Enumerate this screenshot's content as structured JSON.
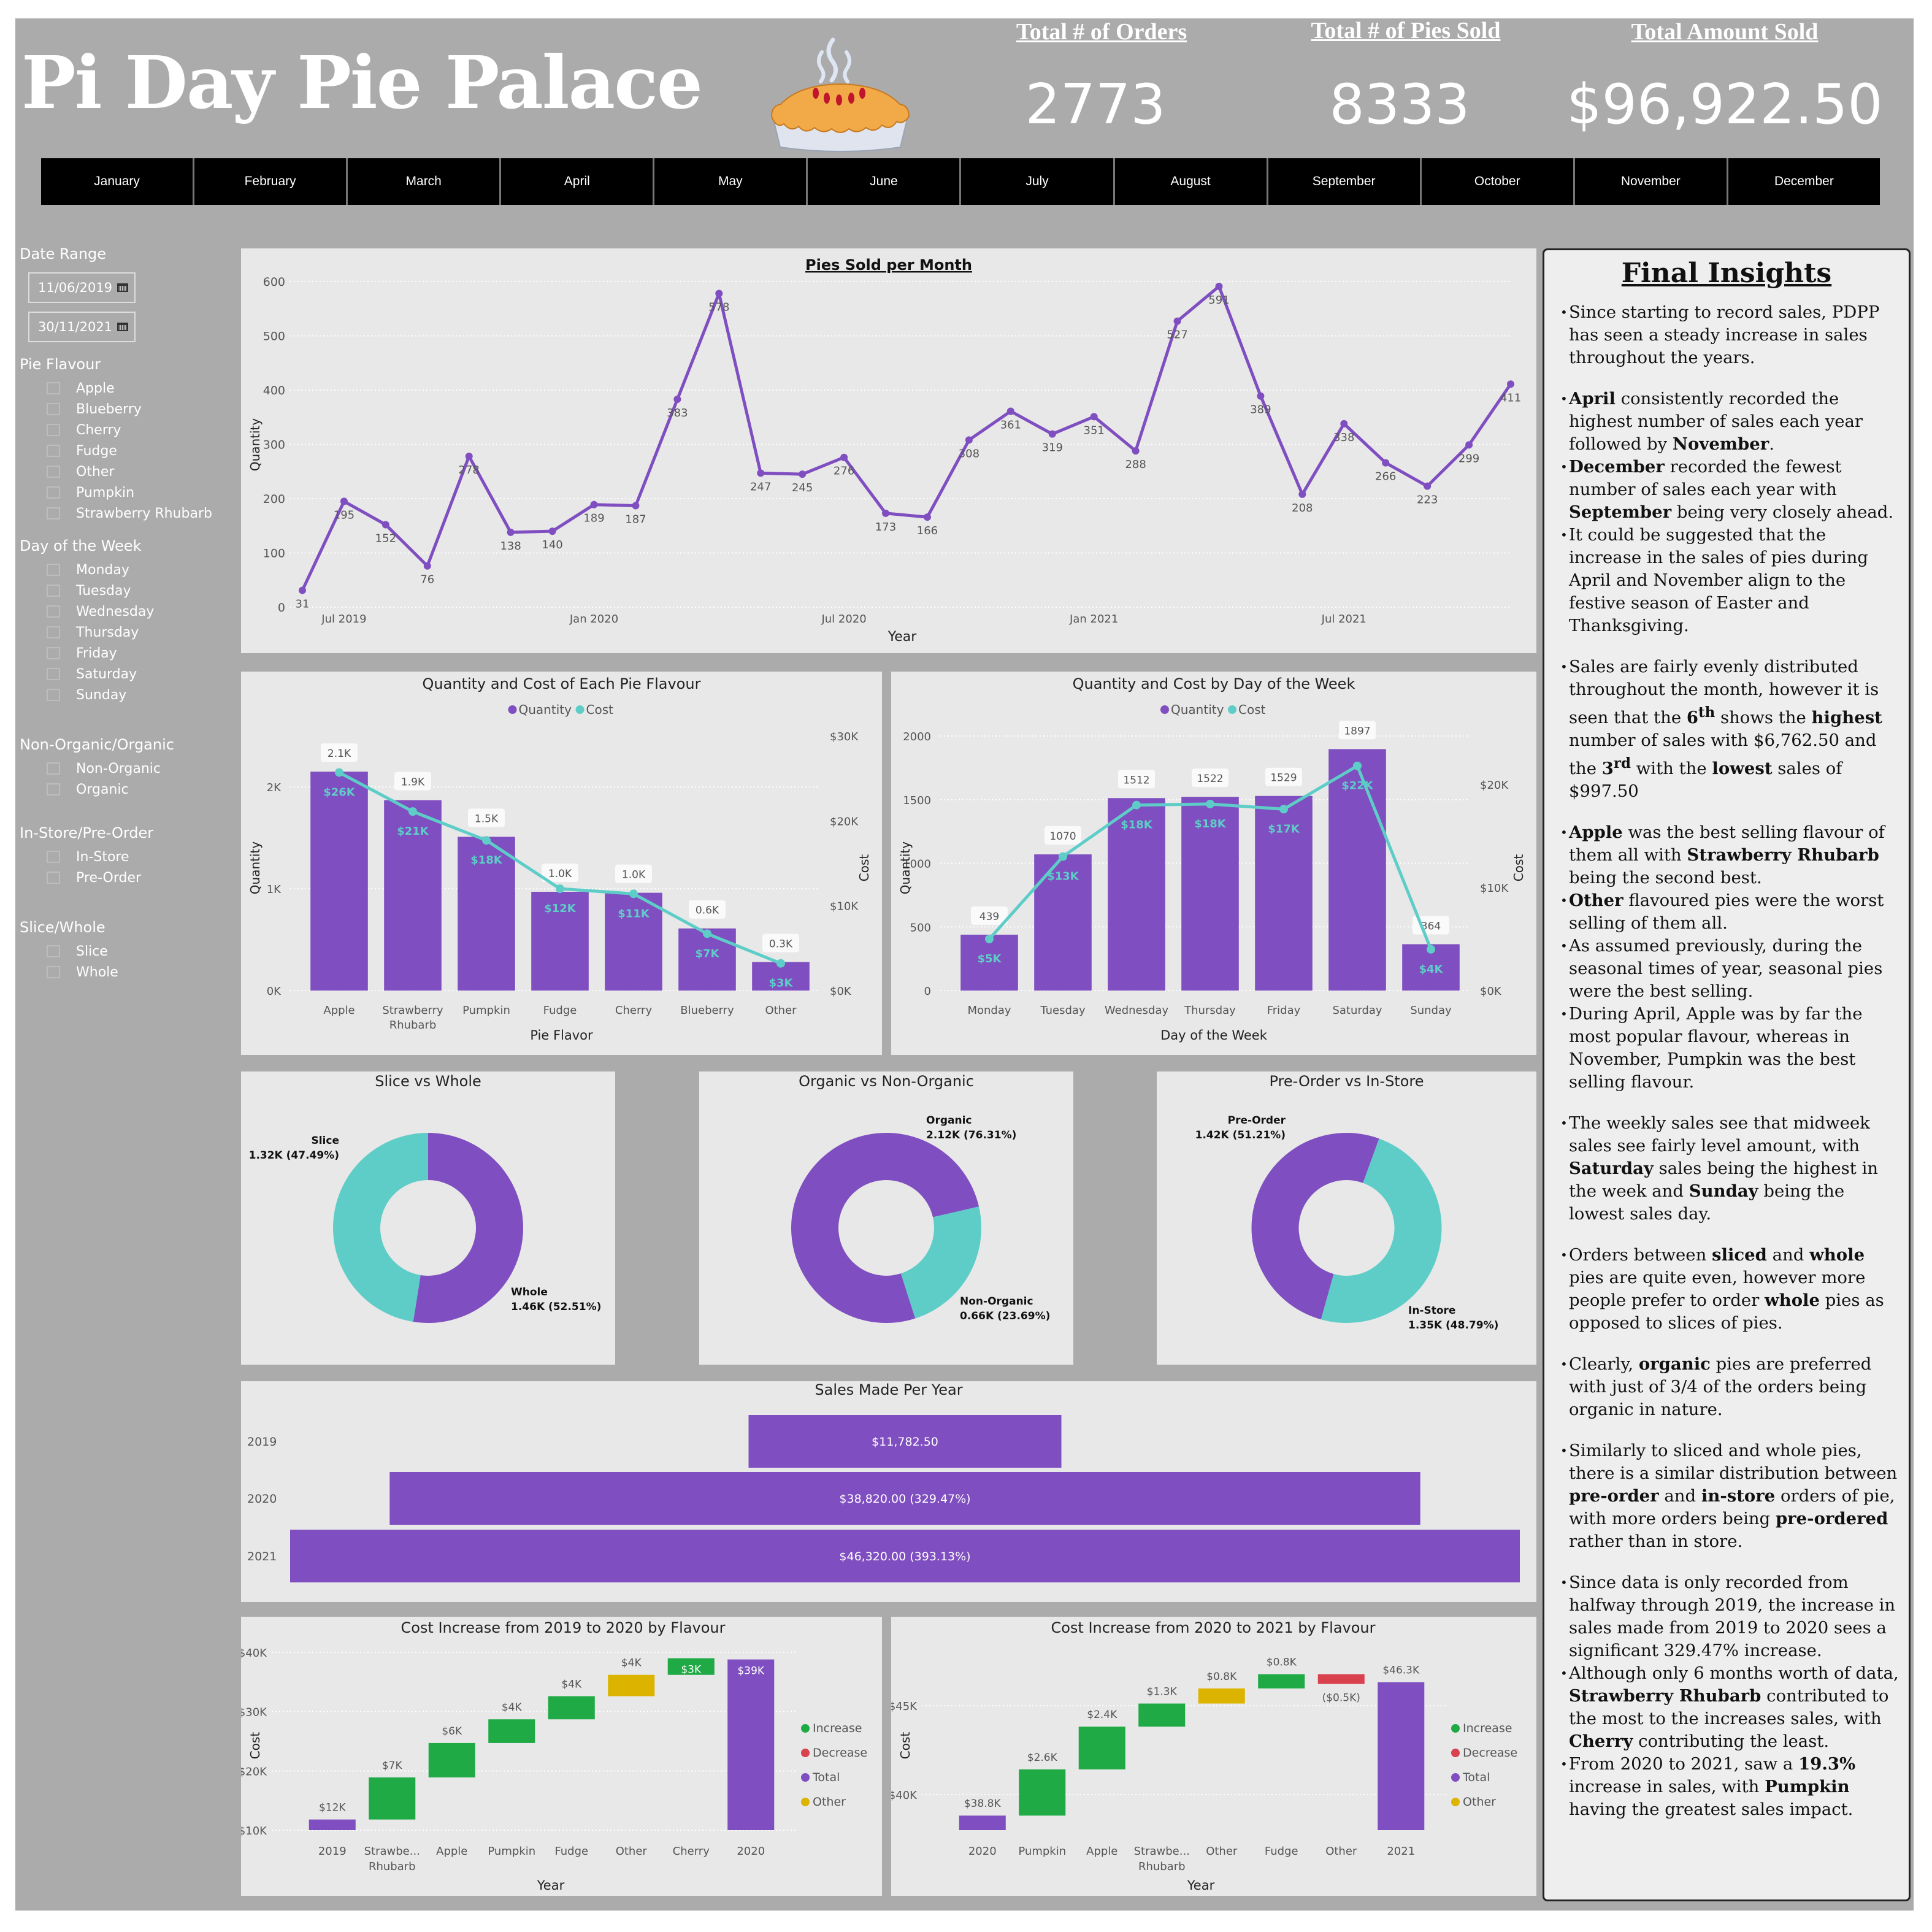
{
  "header": {
    "title": "Pi Day Pie Palace",
    "logo_icon": "pie-icon",
    "kpis": [
      {
        "label": "Total # of Orders",
        "value": "2773"
      },
      {
        "label": "Total # of Pies Sold",
        "value": "8333"
      },
      {
        "label": "Total Amount Sold",
        "value": "$96,922.50"
      }
    ],
    "months": [
      "January",
      "February",
      "March",
      "April",
      "May",
      "June",
      "July",
      "August",
      "September",
      "October",
      "November",
      "December"
    ]
  },
  "filters": {
    "date_range": {
      "label": "Date Range",
      "start": "11/06/2019",
      "end": "30/11/2021",
      "icon": "calendar-icon"
    },
    "groups": [
      {
        "label": "Pie Flavour",
        "options": [
          "Apple",
          "Blueberry",
          "Cherry",
          "Fudge",
          "Other",
          "Pumpkin",
          "Strawberry Rhubarb"
        ]
      },
      {
        "label": "Day of the Week",
        "options": [
          "Monday",
          "Tuesday",
          "Wednesday",
          "Thursday",
          "Friday",
          "Saturday",
          "Sunday"
        ]
      },
      {
        "label": "Non-Organic/Organic",
        "options": [
          "Non-Organic",
          "Organic"
        ]
      },
      {
        "label": "In-Store/Pre-Order",
        "options": [
          "In-Store",
          "Pre-Order"
        ]
      },
      {
        "label": "Slice/Whole",
        "options": [
          "Slice",
          "Whole"
        ]
      }
    ]
  },
  "colors": {
    "purple": "#7f4ec0",
    "teal": "#5ecdc8",
    "green": "#1faa46",
    "red": "#d9414f",
    "gold": "#dcb400",
    "frame": "#ababab",
    "panel": "#e8e8e8"
  },
  "chart_data": [
    {
      "id": "pies-per-month",
      "type": "line",
      "title": "Pies Sold per Month",
      "xlabel": "Year",
      "ylabel": "Quantity",
      "ylim": [
        0,
        600
      ],
      "yticks": [
        0,
        100,
        200,
        300,
        400,
        500,
        600
      ],
      "xtick_labels": [
        {
          "index": 1,
          "label": "Jul 2019"
        },
        {
          "index": 7,
          "label": "Jan 2020"
        },
        {
          "index": 13,
          "label": "Jul 2020"
        },
        {
          "index": 19,
          "label": "Jan 2021"
        },
        {
          "index": 25,
          "label": "Jul 2021"
        }
      ],
      "x": [
        "Jun 2019",
        "Jul 2019",
        "Aug 2019",
        "Sep 2019",
        "Oct 2019",
        "Nov 2019",
        "Dec 2019",
        "Jan 2020",
        "Feb 2020",
        "Mar 2020",
        "Apr 2020",
        "May 2020",
        "Jun 2020",
        "Jul 2020",
        "Aug 2020",
        "Sep 2020",
        "Oct 2020",
        "Nov 2020",
        "Dec 2020",
        "Jan 2021",
        "Feb 2021",
        "Mar 2021",
        "Apr 2021",
        "May 2021",
        "Jun 2021",
        "Jul 2021",
        "Aug 2021",
        "Sep 2021",
        "Oct 2021",
        "Nov 2021"
      ],
      "values": [
        31,
        195,
        152,
        76,
        278,
        138,
        140,
        189,
        187,
        383,
        578,
        247,
        245,
        276,
        173,
        166,
        308,
        361,
        319,
        351,
        288,
        527,
        591,
        389,
        208,
        338,
        266,
        223,
        299,
        411
      ],
      "grid": true
    },
    {
      "id": "flavour-combo",
      "type": "bar",
      "title": "Quantity and Cost of Each Pie Flavour",
      "xlabel": "Pie Flavor",
      "ylabel": "Quantity",
      "y2label": "Cost",
      "legend": [
        "Quantity",
        "Cost"
      ],
      "legend_position": "top-center",
      "categories": [
        "Apple",
        "Strawberry Rhubarb",
        "Pumpkin",
        "Fudge",
        "Cherry",
        "Blueberry",
        "Other"
      ],
      "series": [
        {
          "name": "Quantity",
          "type": "bar",
          "values": [
            2150,
            1870,
            1510,
            970,
            960,
            610,
            280
          ],
          "labels": [
            "2.1K",
            "1.9K",
            "1.5K",
            "1.0K",
            "1.0K",
            "0.6K",
            "0.3K"
          ]
        },
        {
          "name": "Cost",
          "type": "line",
          "values": [
            25700,
            21100,
            17700,
            12000,
            11400,
            6700,
            3200
          ],
          "labels": [
            "$26K",
            "$21K",
            "$18K",
            "$12K",
            "$11K",
            "$7K",
            "$3K"
          ]
        }
      ],
      "ylim": [
        0,
        2500
      ],
      "yticks": [
        {
          "v": 0,
          "l": "0K"
        },
        {
          "v": 1000,
          "l": "1K"
        },
        {
          "v": 2000,
          "l": "2K"
        }
      ],
      "y2lim": [
        0,
        30000
      ],
      "y2ticks": [
        {
          "v": 0,
          "l": "$0K"
        },
        {
          "v": 10000,
          "l": "$10K"
        },
        {
          "v": 20000,
          "l": "$20K"
        },
        {
          "v": 30000,
          "l": "$30K"
        }
      ]
    },
    {
      "id": "weekday-combo",
      "type": "bar",
      "title": "Quantity and Cost by Day of the Week",
      "xlabel": "Day of the Week",
      "ylabel": "Quantity",
      "y2label": "Cost",
      "legend": [
        "Quantity",
        "Cost"
      ],
      "legend_position": "top-center",
      "categories": [
        "Monday",
        "Tuesday",
        "Wednesday",
        "Thursday",
        "Friday",
        "Saturday",
        "Sunday"
      ],
      "series": [
        {
          "name": "Quantity",
          "type": "bar",
          "values": [
            439,
            1070,
            1512,
            1522,
            1529,
            1897,
            364
          ],
          "labels": [
            "439",
            "1070",
            "1512",
            "1522",
            "1529",
            "1897",
            "364"
          ]
        },
        {
          "name": "Cost",
          "type": "line",
          "values": [
            5000,
            13000,
            18000,
            18100,
            17600,
            21800,
            4000
          ],
          "labels": [
            "$5K",
            "$13K",
            "$18K",
            "$18K",
            "$17K",
            "$22K",
            "$4K"
          ]
        }
      ],
      "ylim": [
        0,
        2000
      ],
      "yticks": [
        {
          "v": 0,
          "l": "0"
        },
        {
          "v": 500,
          "l": "500"
        },
        {
          "v": 1000,
          "l": "1000"
        },
        {
          "v": 1500,
          "l": "1500"
        },
        {
          "v": 2000,
          "l": "2000"
        }
      ],
      "y2lim": [
        0,
        24700
      ],
      "y2ticks": [
        {
          "v": 0,
          "l": "$0K"
        },
        {
          "v": 10000,
          "l": "$10K"
        },
        {
          "v": 20000,
          "l": "$20K"
        }
      ]
    },
    {
      "id": "slice-vs-whole",
      "type": "pie",
      "title": "Slice vs Whole",
      "slices": [
        {
          "name": "Whole",
          "value": 1460,
          "label": "1.46K (52.51%)",
          "pct": 52.51,
          "color": "purple"
        },
        {
          "name": "Slice",
          "value": 1320,
          "label": "1.32K (47.49%)",
          "pct": 47.49,
          "color": "teal"
        }
      ]
    },
    {
      "id": "organic-vs-non",
      "type": "pie",
      "title": "Organic vs Non-Organic",
      "slices": [
        {
          "name": "Organic",
          "value": 2120,
          "label": "2.12K (76.31%)",
          "pct": 76.31,
          "color": "purple"
        },
        {
          "name": "Non-Organic",
          "value": 660,
          "label": "0.66K (23.69%)",
          "pct": 23.69,
          "color": "teal"
        }
      ]
    },
    {
      "id": "preorder-vs-instore",
      "type": "pie",
      "title": "Pre-Order vs In-Store",
      "slices": [
        {
          "name": "Pre-Order",
          "value": 1420,
          "label": "1.42K (51.21%)",
          "pct": 51.21,
          "color": "purple"
        },
        {
          "name": "In-Store",
          "value": 1350,
          "label": "1.35K (48.79%)",
          "pct": 48.79,
          "color": "teal"
        }
      ]
    },
    {
      "id": "sales-per-year",
      "type": "bar",
      "title": "Sales Made Per Year",
      "orientation": "funnel",
      "categories": [
        "2019",
        "2020",
        "2021"
      ],
      "values": [
        11782.5,
        38820.0,
        46320.0
      ],
      "labels": [
        "$11,782.50",
        "$38,820.00 (329.47%)",
        "$46,320.00 (393.13%)"
      ]
    },
    {
      "id": "waterfall-2019-2020",
      "type": "bar",
      "subtype": "waterfall",
      "title": "Cost Increase from 2019 to 2020 by Flavour",
      "xlabel": "Year",
      "ylabel": "Cost",
      "ylim": [
        10000,
        40000
      ],
      "yticks": [
        {
          "v": 10000,
          "l": "$10K"
        },
        {
          "v": 20000,
          "l": "$20K"
        },
        {
          "v": 30000,
          "l": "$30K"
        },
        {
          "v": 40000,
          "l": "$40K"
        }
      ],
      "legend": [
        "Increase",
        "Decrease",
        "Total",
        "Other"
      ],
      "legend_position": "right",
      "steps": [
        {
          "cat": "2019",
          "cat2": "",
          "kind": "total",
          "value": 11800,
          "label": "$12K"
        },
        {
          "cat": "Strawbe...",
          "cat2": "Rhubarb",
          "kind": "increase",
          "value": 7100,
          "label": "$7K"
        },
        {
          "cat": "Apple",
          "cat2": "",
          "kind": "increase",
          "value": 5800,
          "label": "$6K"
        },
        {
          "cat": "Pumpkin",
          "cat2": "",
          "kind": "increase",
          "value": 4000,
          "label": "$4K"
        },
        {
          "cat": "Fudge",
          "cat2": "",
          "kind": "increase",
          "value": 3900,
          "label": "$4K"
        },
        {
          "cat": "Other",
          "cat2": "",
          "kind": "other",
          "value": 3600,
          "label": "$4K"
        },
        {
          "cat": "Cherry",
          "cat2": "",
          "kind": "increase",
          "value": 2800,
          "label": "$3K"
        },
        {
          "cat": "2020",
          "cat2": "",
          "kind": "total",
          "value": 38800,
          "label": "$39K"
        }
      ]
    },
    {
      "id": "waterfall-2020-2021",
      "type": "bar",
      "subtype": "waterfall",
      "title": "Cost Increase from 2020 to 2021 by Flavour",
      "xlabel": "Year",
      "ylabel": "Cost",
      "ylim": [
        38000,
        48000
      ],
      "yticks": [
        {
          "v": 40000,
          "l": "$40K"
        },
        {
          "v": 45000,
          "l": "$45K"
        }
      ],
      "legend": [
        "Increase",
        "Decrease",
        "Total",
        "Other"
      ],
      "legend_position": "right",
      "steps": [
        {
          "cat": "2020",
          "cat2": "",
          "kind": "total",
          "value": 38820,
          "label": "$38.8K"
        },
        {
          "cat": "Pumpkin",
          "cat2": "",
          "kind": "increase",
          "value": 2600,
          "label": "$2.6K"
        },
        {
          "cat": "Apple",
          "cat2": "",
          "kind": "increase",
          "value": 2400,
          "label": "$2.4K"
        },
        {
          "cat": "Strawbe...",
          "cat2": "Rhubarb",
          "kind": "increase",
          "value": 1300,
          "label": "$1.3K"
        },
        {
          "cat": "Other",
          "cat2": "",
          "kind": "other",
          "value": 850,
          "label": "$0.8K"
        },
        {
          "cat": "Fudge",
          "cat2": "",
          "kind": "increase",
          "value": 800,
          "label": "$0.8K"
        },
        {
          "cat": "Other",
          "cat2": "",
          "kind": "decrease",
          "value": -550,
          "label": "($0.5K)"
        },
        {
          "cat": "2021",
          "cat2": "",
          "kind": "total",
          "value": 46320,
          "label": "$46.3K"
        }
      ]
    }
  ],
  "insights": {
    "title": "Final Insights",
    "items": [
      {
        "gap": false,
        "html": "Since starting to record sales, PDPP has seen a steady increase in sales throughout the years."
      },
      {
        "gap": true,
        "html": "<b>April</b> consistently recorded the highest number of sales each year followed by <b>November</b>."
      },
      {
        "gap": false,
        "html": "<b>December</b> recorded the fewest number of sales each year with <b>September</b> being very closely ahead."
      },
      {
        "gap": false,
        "html": "It could be suggested that the increase in the sales of pies during April and November align to the festive season of Easter and Thanksgiving."
      },
      {
        "gap": true,
        "html": "Sales are fairly evenly distributed throughout the month, however it is seen that the <b>6<sup>th</sup></b> shows the <b>highest</b> number of sales with $6,762.50 and the <b>3<sup>rd</sup></b> with the <b>lowest</b> sales of $997.50"
      },
      {
        "gap": true,
        "html": "<b>Apple</b> was the best selling flavour of them all with <b>Strawberry Rhubarb</b> being the second best."
      },
      {
        "gap": false,
        "html": "<b>Other</b> flavoured pies were the worst selling of them all."
      },
      {
        "gap": false,
        "html": "As assumed previously, during the seasonal times of year, seasonal pies were the best selling."
      },
      {
        "gap": false,
        "html": "During April, Apple was by far the most popular flavour, whereas in November, Pumpkin was the best selling flavour."
      },
      {
        "gap": true,
        "html": "The weekly sales see that midweek sales see fairly level amount, with <b>Saturday</b> sales being the highest in the week and <b>Sunday</b> being the lowest sales day."
      },
      {
        "gap": true,
        "html": "Orders between <b>sliced</b> and <b>whole</b> pies are quite even, however more people prefer to order <b>whole</b> pies as opposed to slices of pies."
      },
      {
        "gap": true,
        "html": "Clearly, <b>organic</b> pies are preferred with just of 3/4 of the orders being organic in nature."
      },
      {
        "gap": true,
        "html": "Similarly to sliced and whole pies, there is a similar distribution between <b>pre-order</b> and <b>in-store</b> orders of pie, with more orders being <b>pre-ordered</b> rather than in store."
      },
      {
        "gap": true,
        "html": "Since data is only recorded from halfway through 2019, the increase in sales made from 2019 to 2020 sees a significant 329.47% increase."
      },
      {
        "gap": false,
        "html": "Although only 6 months worth of data, <b>Strawberry Rhubarb</b> contributed to the most to the increases sales, with <b>Cherry</b> contributing the least."
      },
      {
        "gap": false,
        "html": "From 2020 to 2021, saw a <b>19.3%</b> increase in sales, with <b>Pumpkin</b> having the greatest sales impact."
      }
    ]
  }
}
